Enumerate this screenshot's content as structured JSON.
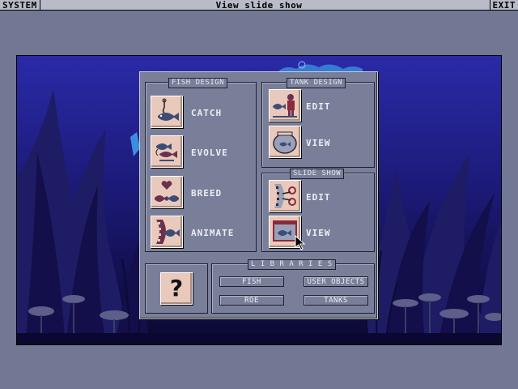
{
  "menubar": {
    "system": "SYSTEM",
    "title": "View slide show",
    "exit": "EXIT"
  },
  "fish_design": {
    "title": "FISH DESIGN",
    "items": [
      {
        "label": "CATCH",
        "icon": "fishing-hook-icon"
      },
      {
        "label": "EVOLVE",
        "icon": "evolve-fish-icon"
      },
      {
        "label": "BREED",
        "icon": "breed-hearts-icon"
      },
      {
        "label": "ANIMATE",
        "icon": "film-fish-icon"
      }
    ]
  },
  "tank_design": {
    "title": "TANK DESIGN",
    "items": [
      {
        "label": "EDIT",
        "icon": "diver-fish-icon"
      },
      {
        "label": "VIEW",
        "icon": "fishbowl-icon"
      }
    ]
  },
  "slide_show": {
    "title": "SLIDE SHOW",
    "items": [
      {
        "label": "EDIT",
        "icon": "film-scissors-icon"
      },
      {
        "label": "VIEW",
        "icon": "slide-viewer-icon"
      }
    ]
  },
  "help": {
    "label": "?"
  },
  "libraries": {
    "title": "L I B R A R I E S",
    "buttons": [
      "FISH",
      "USER OBJECTS",
      "ROE",
      "TANKS"
    ]
  },
  "colors": {
    "background": "#727794",
    "panel": "#7a7f99",
    "icon_button": "#e9c9bb",
    "scene_water": "#1b1870"
  }
}
